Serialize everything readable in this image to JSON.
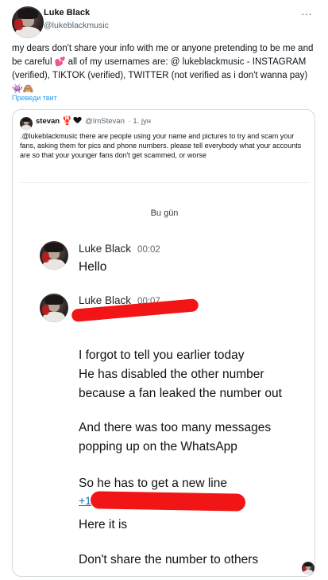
{
  "tweet": {
    "author_name": "Luke Black",
    "author_handle": "@lukeblackmusic",
    "text_part1": "my dears don't share your info with me or anyone pretending to be me and be careful ",
    "emoji_hearts": "💕",
    "text_part2": " all of my usernames are: @ lukeblackmusic - INSTAGRAM (verified), TIKTOK (verified), TWITTER (not verified as i don't wanna pay) ",
    "emoji_end": "👾🙈",
    "translate_link": "Преведи твит"
  },
  "quote": {
    "author_name": "stevan",
    "author_emoji": "🦞",
    "author_handle": "@ImStevan",
    "date": "· 1. јун",
    "text": ".@lukeblackmusic there are people using your name and pictures to try and scam your fans, asking them for pics and phone numbers. please tell everybody what your accounts are so that your younger fans don't get scammed, or worse"
  },
  "screenshot": {
    "date_separator": "Bu gün",
    "message1": {
      "sender": "Luke Black",
      "time": "00:02",
      "text": "Hello"
    },
    "message2": {
      "sender": "Luke Black",
      "time": "00:07",
      "lines": [
        "I forgot to tell you earlier today",
        "He has disabled the other number",
        "because a fan leaked the number out",
        "And there was too many messages",
        "popping up on the WhatsApp",
        "So he has to get a new line",
        "Here it is",
        "Don't share the number to others"
      ],
      "phone_prefix": "+1"
    }
  },
  "icons": {
    "more": "more-horizontal-icon",
    "more_glyph": "···"
  },
  "colors": {
    "link_blue": "#1d9bf0",
    "redaction_red": "#f21515",
    "secondary_text": "#536471"
  }
}
